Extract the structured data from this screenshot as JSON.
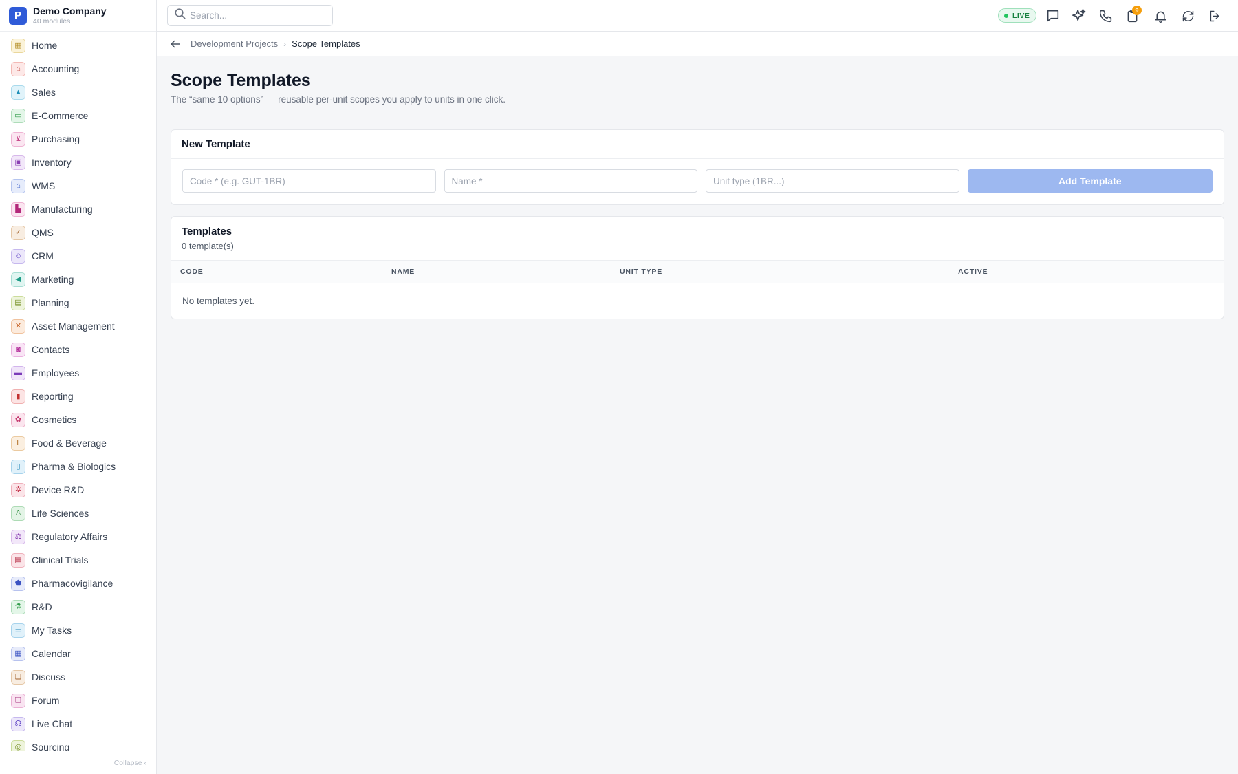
{
  "company": {
    "initial": "P",
    "name": "Demo Company",
    "sub": "40 modules"
  },
  "sidebar": {
    "items": [
      {
        "label": "Home",
        "icon": "grid-icon",
        "glyph": "▦",
        "color": "#b08a1f",
        "bg": "#fbf3d9",
        "border": "#ead79c"
      },
      {
        "label": "Accounting",
        "icon": "bank-icon",
        "glyph": "⌂",
        "color": "#c2413b",
        "bg": "#fde8e7",
        "border": "#f3b9b5"
      },
      {
        "label": "Sales",
        "icon": "tag-icon",
        "glyph": "▲",
        "color": "#1f8fb8",
        "bg": "#e0f3fa",
        "border": "#a9daec"
      },
      {
        "label": "E-Commerce",
        "icon": "store-icon",
        "glyph": "▭",
        "color": "#2e9a47",
        "bg": "#e3f6e8",
        "border": "#aedcb9"
      },
      {
        "label": "Purchasing",
        "icon": "cart-icon",
        "glyph": "⊻",
        "color": "#c0367e",
        "bg": "#fbe6f1",
        "border": "#efb3d3"
      },
      {
        "label": "Inventory",
        "icon": "box-icon",
        "glyph": "▣",
        "color": "#8a3fb3",
        "bg": "#f2e7f9",
        "border": "#d7b8ea"
      },
      {
        "label": "WMS",
        "icon": "warehouse-icon",
        "glyph": "⌂",
        "color": "#2e55c6",
        "bg": "#e6ecfb",
        "border": "#b4c4ef"
      },
      {
        "label": "Manufacturing",
        "icon": "factory-icon",
        "glyph": "▙",
        "color": "#b3287a",
        "bg": "#fbe5f0",
        "border": "#efb1d2"
      },
      {
        "label": "QMS",
        "icon": "badge-check-icon",
        "glyph": "✓",
        "color": "#a0602a",
        "bg": "#f8ede1",
        "border": "#e5c7a6"
      },
      {
        "label": "CRM",
        "icon": "users-icon",
        "glyph": "☺",
        "color": "#5b3fc2",
        "bg": "#ece7fa",
        "border": "#c6b8ee"
      },
      {
        "label": "Marketing",
        "icon": "megaphone-icon",
        "glyph": "◀",
        "color": "#1e9b86",
        "bg": "#e0f5f1",
        "border": "#a7ddd3"
      },
      {
        "label": "Planning",
        "icon": "calendar-grid-icon",
        "glyph": "▤",
        "color": "#6f8a1c",
        "bg": "#eef4dc",
        "border": "#cbdc9b"
      },
      {
        "label": "Asset Management",
        "icon": "tools-icon",
        "glyph": "✕",
        "color": "#c25a1a",
        "bg": "#fcebdd",
        "border": "#f0c29d"
      },
      {
        "label": "Contacts",
        "icon": "contact-card-icon",
        "glyph": "◙",
        "color": "#b22f9a",
        "bg": "#f9e4f5",
        "border": "#ebb0df"
      },
      {
        "label": "Employees",
        "icon": "briefcase-icon",
        "glyph": "▬",
        "color": "#7a3ab8",
        "bg": "#f0e5f9",
        "border": "#d2b4ec"
      },
      {
        "label": "Reporting",
        "icon": "bar-chart-icon",
        "glyph": "▮",
        "color": "#c23030",
        "bg": "#fce4e4",
        "border": "#f0b0b0"
      },
      {
        "label": "Cosmetics",
        "icon": "flower-icon",
        "glyph": "✿",
        "color": "#c2346a",
        "bg": "#fbe5ee",
        "border": "#efb2c9"
      },
      {
        "label": "Food & Beverage",
        "icon": "utensils-icon",
        "glyph": "ǁ",
        "color": "#b06a1e",
        "bg": "#fbefe0",
        "border": "#ebcaa0"
      },
      {
        "label": "Pharma & Biologics",
        "icon": "pill-bottle-icon",
        "glyph": "▯",
        "color": "#1f86b8",
        "bg": "#e0f1fa",
        "border": "#a7d3ec"
      },
      {
        "label": "Device R&D",
        "icon": "cog-icon",
        "glyph": "✲",
        "color": "#c2334a",
        "bg": "#fbe4e8",
        "border": "#efb0bb"
      },
      {
        "label": "Life Sciences",
        "icon": "microscope-icon",
        "glyph": "♙",
        "color": "#2e8a3e",
        "bg": "#e3f4e6",
        "border": "#addbb5"
      },
      {
        "label": "Regulatory Affairs",
        "icon": "gavel-icon",
        "glyph": "⚖",
        "color": "#8a3fb3",
        "bg": "#f2e7f9",
        "border": "#d7b8ea"
      },
      {
        "label": "Clinical Trials",
        "icon": "clipboard-icon",
        "glyph": "▤",
        "color": "#b8334a",
        "bg": "#fbe4e8",
        "border": "#efb0bb"
      },
      {
        "label": "Pharmacovigilance",
        "icon": "shield-icon",
        "glyph": "⬟",
        "color": "#3a52c2",
        "bg": "#e7ebfa",
        "border": "#b7c2ee"
      },
      {
        "label": "R&D",
        "icon": "flask-icon",
        "glyph": "⚗",
        "color": "#2e9a47",
        "bg": "#e3f6e8",
        "border": "#aedcb9"
      },
      {
        "label": "My Tasks",
        "icon": "checklist-icon",
        "glyph": "☰",
        "color": "#1f86b8",
        "bg": "#e0f1fa",
        "border": "#a7d3ec"
      },
      {
        "label": "Calendar",
        "icon": "calendar-icon",
        "glyph": "▦",
        "color": "#3a52c2",
        "bg": "#e7ebfa",
        "border": "#b7c2ee"
      },
      {
        "label": "Discuss",
        "icon": "chat-bubbles-icon",
        "glyph": "❑",
        "color": "#a0602a",
        "bg": "#f8ede1",
        "border": "#e5c7a6"
      },
      {
        "label": "Forum",
        "icon": "forum-icon",
        "glyph": "❑",
        "color": "#a32f7a",
        "bg": "#f9e4f1",
        "border": "#ebb0d4"
      },
      {
        "label": "Live Chat",
        "icon": "headset-icon",
        "glyph": "☊",
        "color": "#5b3fc2",
        "bg": "#ece7fa",
        "border": "#c6b8ee"
      },
      {
        "label": "Sourcing",
        "icon": "sourcing-icon",
        "glyph": "◎",
        "color": "#6f8a1c",
        "bg": "#eef4dc",
        "border": "#cbdc9b"
      }
    ],
    "collapse_label": "Collapse ‹"
  },
  "topbar": {
    "search_placeholder": "Search...",
    "live_label": "LIVE",
    "notification_badge": "9",
    "icons": [
      "chat-icon",
      "sparkles-icon",
      "phone-icon",
      "clipboard-badge-icon",
      "bell-icon",
      "refresh-icon",
      "logout-icon"
    ]
  },
  "breadcrumb": {
    "parent": "Development Projects",
    "separator": "›",
    "current": "Scope Templates"
  },
  "page": {
    "title": "Scope Templates",
    "subtitle": "The “same 10 options” — reusable per-unit scopes you apply to units in one click."
  },
  "new_template": {
    "heading": "New Template",
    "code_placeholder": "Code * (e.g. GUT-1BR)",
    "name_placeholder": "Name *",
    "unit_type_placeholder": "Unit type (1BR...)",
    "add_label": "Add Template"
  },
  "templates": {
    "heading": "Templates",
    "count": "0 template(s)",
    "columns": [
      "CODE",
      "NAME",
      "UNIT TYPE",
      "ACTIVE"
    ],
    "empty_text": "No templates yet."
  },
  "colors": {
    "accent": "#2f5bd8",
    "button_disabled": "#9db8f0",
    "live_green": "#15803d",
    "badge": "#f59e0b"
  }
}
